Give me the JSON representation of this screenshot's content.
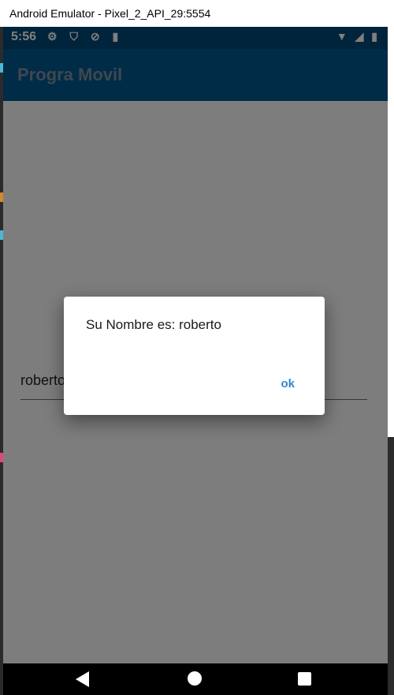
{
  "window": {
    "title": "Android Emulator - Pixel_2_API_29:5554"
  },
  "status_bar": {
    "time": "5:56",
    "left_icons": [
      "gear-icon",
      "shield-icon",
      "sync-icon",
      "sd-card-icon"
    ],
    "right_icons": [
      "wifi-icon",
      "signal-icon",
      "battery-icon"
    ]
  },
  "app_bar": {
    "title": "Progra Movil"
  },
  "form": {
    "name_value": "roberto"
  },
  "dialog": {
    "message": "Su Nombre es: roberto",
    "ok_label": "ok"
  },
  "fab": {
    "label": "+"
  },
  "colors": {
    "status_bar": "#004878",
    "app_bar": "#02588f",
    "accent": "#1f73b0",
    "dialog_button": "#2f86d3"
  }
}
